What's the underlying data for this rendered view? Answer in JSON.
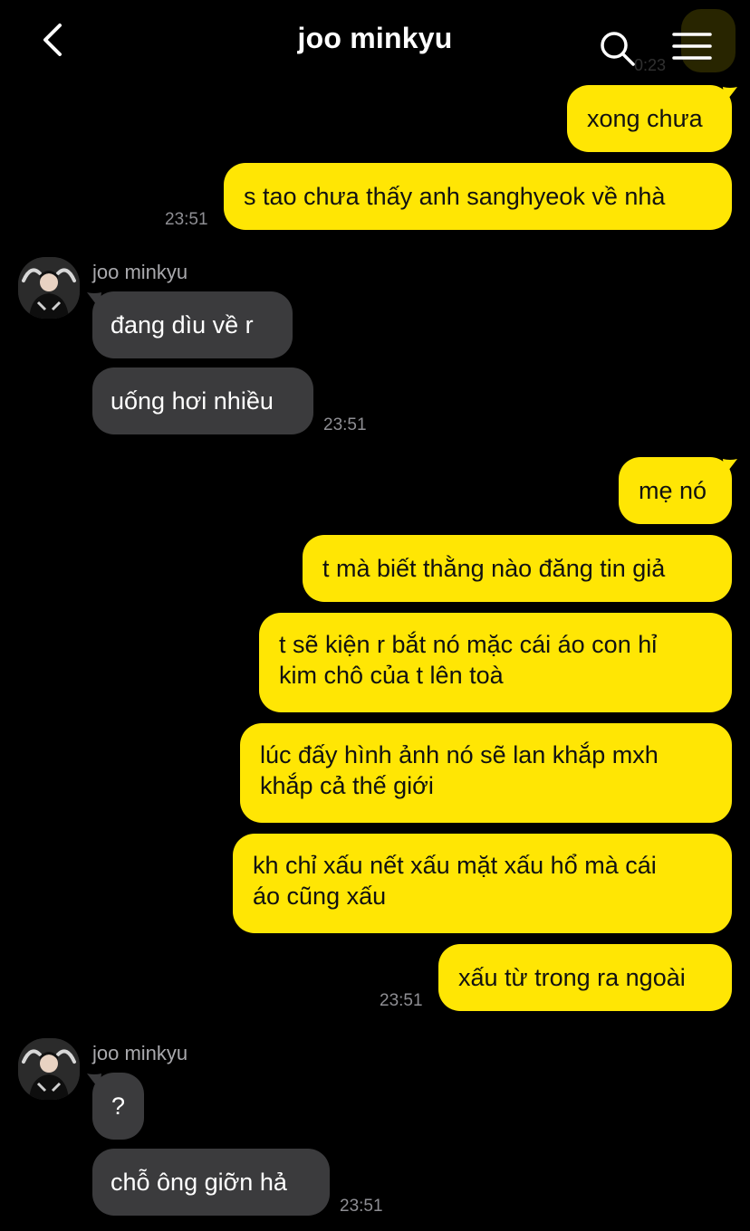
{
  "header": {
    "title": "joo minkyu",
    "back_icon": "chevron-left-icon",
    "search_icon": "search-icon",
    "menu_icon": "hamburger-menu-icon",
    "ghost_time": "0:23"
  },
  "colors": {
    "background": "#000000",
    "outgoing_bubble": "#ffe604",
    "incoming_bubble": "#3b3b3d",
    "timestamp": "#8e8e93"
  },
  "messages": {
    "m1": "xong chưa",
    "m2": "s tao chưa thấy anh sanghyeok về nhà",
    "t1": "23:51",
    "sender1": "joo minkyu",
    "m3": "đang dìu về r",
    "m4": "uống hơi nhiều",
    "t2": "23:51",
    "m5": "mẹ nó",
    "m6": "t mà biết thằng nào đăng tin giả",
    "m7_l1": "t sẽ kiện r bắt nó mặc cái áo con hỉ",
    "m7_l2": "kim chô của t lên toà",
    "m8_l1": "lúc đấy hình ảnh nó sẽ lan khắp mxh",
    "m8_l2": "khắp cả thế giới",
    "m9_l1": "kh chỉ xấu nết xấu mặt xấu hổ mà cái",
    "m9_l2": "áo cũng xấu",
    "m10": "xấu từ trong ra ngoài",
    "t3": "23:51",
    "sender2": "joo minkyu",
    "m11": "?",
    "m12": "chỗ ông giỡn hả",
    "t4": "23:51"
  }
}
